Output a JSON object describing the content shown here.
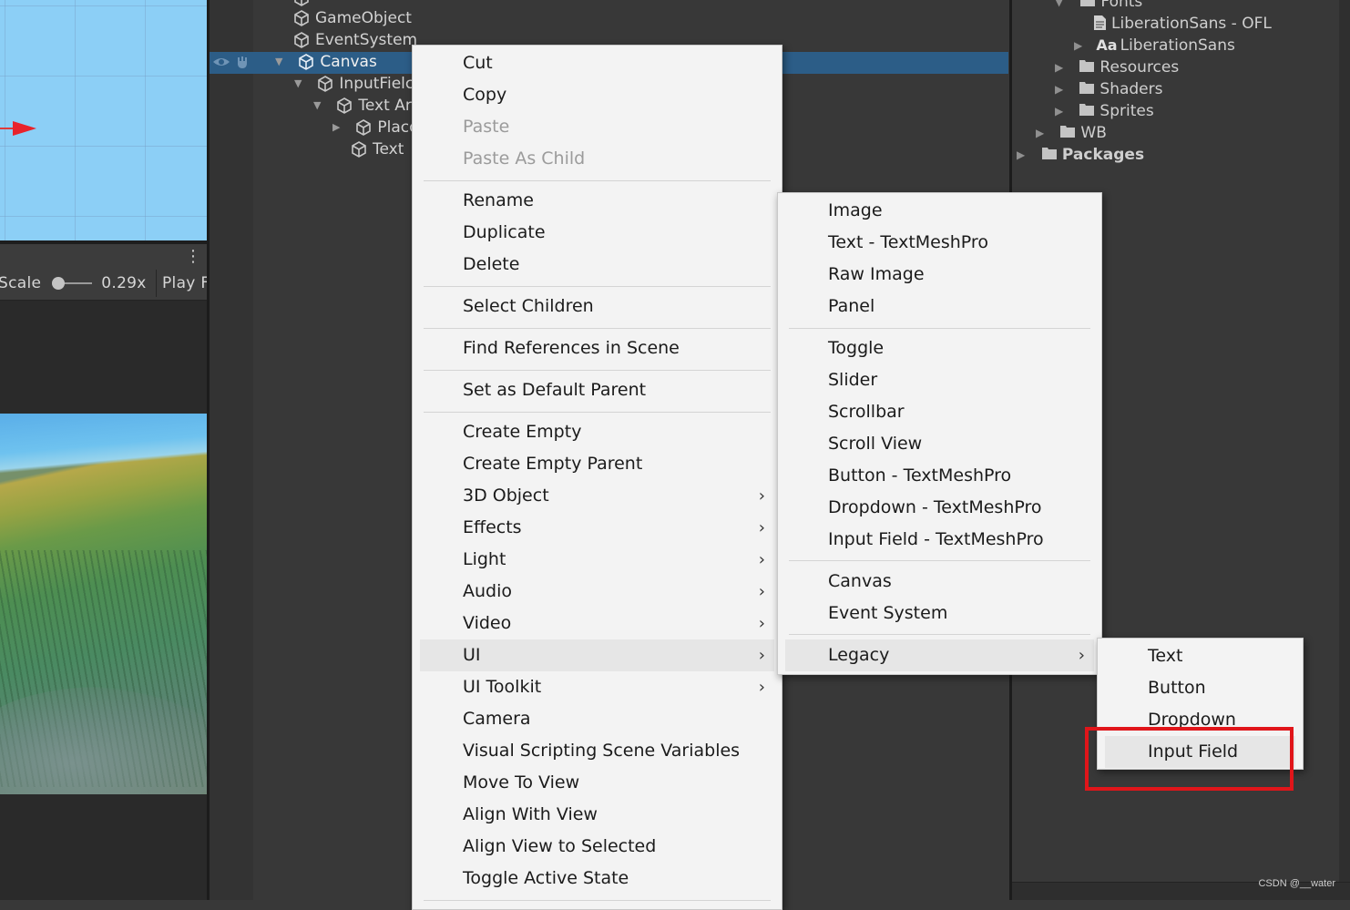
{
  "game_toolbar": {
    "scale_label": "Scale",
    "scale_value": "0.29x",
    "play_focus_label": "Play F"
  },
  "hierarchy": {
    "items": [
      {
        "label": "GameObject"
      },
      {
        "label": "EventSystem"
      },
      {
        "label": "Canvas"
      },
      {
        "label": "InputFielc"
      },
      {
        "label": "Text Ar"
      },
      {
        "label": "Placo"
      },
      {
        "label": "Text"
      }
    ]
  },
  "project": {
    "items": [
      {
        "label": "Fonts"
      },
      {
        "label": "LiberationSans - OFL"
      },
      {
        "label": "LiberationSans"
      },
      {
        "label": "Resources"
      },
      {
        "label": "Shaders"
      },
      {
        "label": "Sprites"
      },
      {
        "label": "WB"
      },
      {
        "label": "Packages"
      }
    ],
    "font_asset_prefix": "Aa"
  },
  "context_menu": {
    "items": [
      {
        "label": "Cut"
      },
      {
        "label": "Copy"
      },
      {
        "label": "Paste"
      },
      {
        "label": "Paste As Child"
      },
      {
        "label": "Rename"
      },
      {
        "label": "Duplicate"
      },
      {
        "label": "Delete"
      },
      {
        "label": "Select Children"
      },
      {
        "label": "Find References in Scene"
      },
      {
        "label": "Set as Default Parent"
      },
      {
        "label": "Create Empty"
      },
      {
        "label": "Create Empty Parent"
      },
      {
        "label": "3D Object"
      },
      {
        "label": "Effects"
      },
      {
        "label": "Light"
      },
      {
        "label": "Audio"
      },
      {
        "label": "Video"
      },
      {
        "label": "UI"
      },
      {
        "label": "UI Toolkit"
      },
      {
        "label": "Camera"
      },
      {
        "label": "Visual Scripting Scene Variables"
      },
      {
        "label": "Move To View"
      },
      {
        "label": "Align With View"
      },
      {
        "label": "Align View to Selected"
      },
      {
        "label": "Toggle Active State"
      }
    ]
  },
  "ui_submenu": {
    "items": [
      {
        "label": "Image"
      },
      {
        "label": "Text - TextMeshPro"
      },
      {
        "label": "Raw Image"
      },
      {
        "label": "Panel"
      },
      {
        "label": "Toggle"
      },
      {
        "label": "Slider"
      },
      {
        "label": "Scrollbar"
      },
      {
        "label": "Scroll View"
      },
      {
        "label": "Button - TextMeshPro"
      },
      {
        "label": "Dropdown - TextMeshPro"
      },
      {
        "label": "Input Field - TextMeshPro"
      },
      {
        "label": "Canvas"
      },
      {
        "label": "Event System"
      },
      {
        "label": "Legacy"
      }
    ]
  },
  "legacy_submenu": {
    "items": [
      {
        "label": "Text"
      },
      {
        "label": "Button"
      },
      {
        "label": "Dropdown"
      },
      {
        "label": "Input Field"
      }
    ]
  },
  "chevron_glyph": "›",
  "watermark": "CSDN @__water",
  "colors": {
    "selection": "#2c5d87",
    "menu_bg": "#f3f3f3",
    "highlight_box": "#e0151a",
    "scene_sky": "#8ccff6"
  }
}
